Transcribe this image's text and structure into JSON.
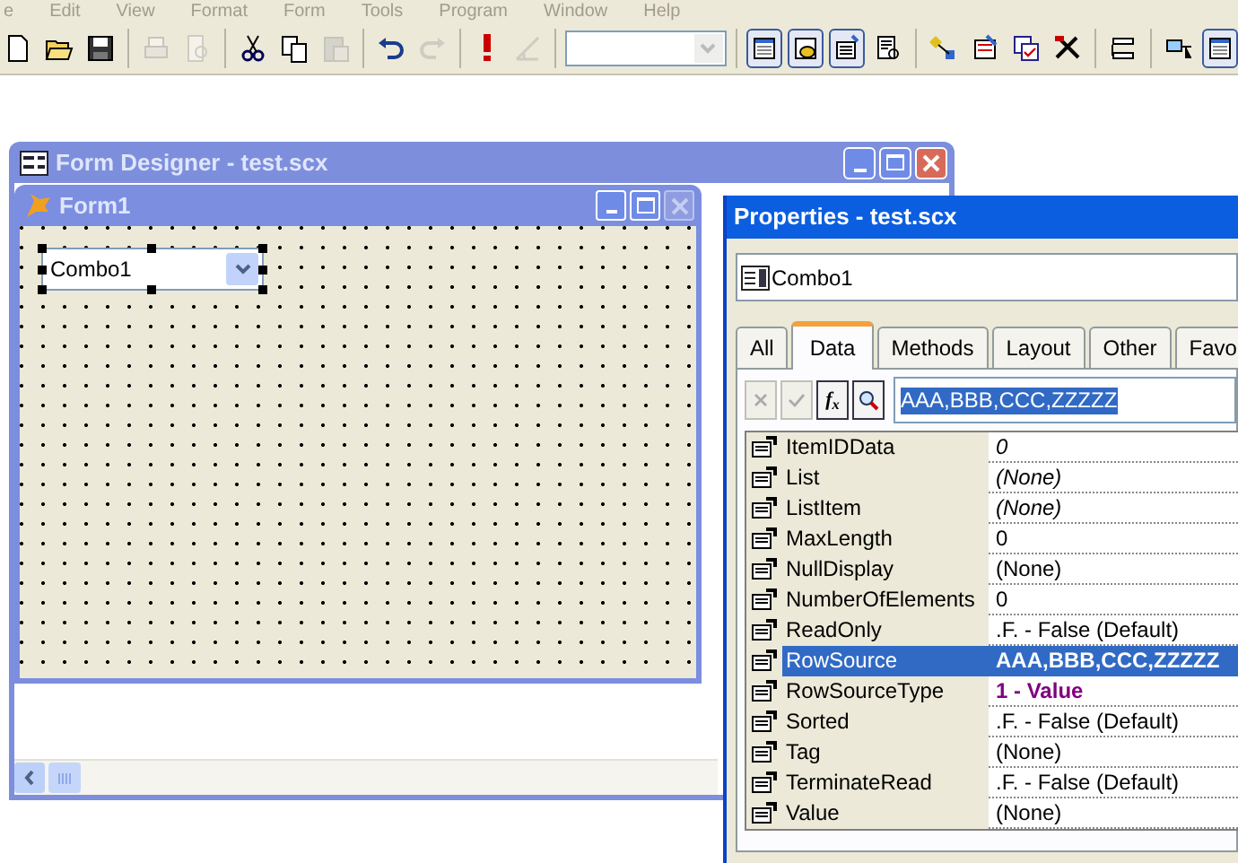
{
  "menu_bar": [
    "e",
    "Edit",
    "View",
    "Format",
    "Form",
    "Tools",
    "Program",
    "Window",
    "Help"
  ],
  "toolbar": [
    {
      "kind": "new",
      "disabled": false
    },
    {
      "kind": "open",
      "disabled": false
    },
    {
      "kind": "save",
      "disabled": false
    },
    {
      "kind": "sep"
    },
    {
      "kind": "print",
      "disabled": true
    },
    {
      "kind": "preview",
      "disabled": true
    },
    {
      "kind": "sep"
    },
    {
      "kind": "cut",
      "disabled": false
    },
    {
      "kind": "copy",
      "disabled": false
    },
    {
      "kind": "paste",
      "disabled": true
    },
    {
      "kind": "sep"
    },
    {
      "kind": "undo",
      "disabled": false
    },
    {
      "kind": "redo",
      "disabled": true
    },
    {
      "kind": "sep"
    },
    {
      "kind": "run",
      "disabled": false
    },
    {
      "kind": "wizard",
      "disabled": true
    },
    {
      "kind": "sep"
    },
    {
      "kind": "combo"
    },
    {
      "kind": "sep"
    },
    {
      "kind": "form",
      "pressed": true
    },
    {
      "kind": "data",
      "pressed": true
    },
    {
      "kind": "props",
      "pressed": true
    },
    {
      "kind": "code",
      "pressed": false
    },
    {
      "kind": "sep"
    },
    {
      "kind": "layout",
      "pressed": false
    },
    {
      "kind": "builder",
      "pressed": false
    },
    {
      "kind": "check",
      "pressed": false
    },
    {
      "kind": "tools",
      "pressed": false
    },
    {
      "kind": "sep"
    },
    {
      "kind": "list",
      "pressed": false
    },
    {
      "kind": "sep"
    },
    {
      "kind": "connect",
      "pressed": false
    },
    {
      "kind": "form",
      "pressed": true
    }
  ],
  "form_designer": {
    "title": "Form Designer - test.scx",
    "form": {
      "title": "Form1",
      "combo": "Combo1"
    }
  },
  "properties": {
    "title": "Properties - test.scx",
    "object": "Combo1",
    "tabs": [
      {
        "label": "All",
        "selected": false
      },
      {
        "label": "Data",
        "selected": true
      },
      {
        "label": "Methods",
        "selected": false
      },
      {
        "label": "Layout",
        "selected": false
      },
      {
        "label": "Other",
        "selected": false
      },
      {
        "label": "Favo",
        "selected": false
      }
    ],
    "function_button": "f$_{x}$",
    "edit_value": "AAA,BBB,CCC,ZZZZZ",
    "rows": [
      {
        "name": "ItemIDData",
        "value": "0",
        "kind": "readonly",
        "selected": false
      },
      {
        "name": "List",
        "value": "(None)",
        "kind": "readonly",
        "selected": false
      },
      {
        "name": "ListItem",
        "value": "(None)",
        "kind": "readonly",
        "selected": false
      },
      {
        "name": "MaxLength",
        "value": "0",
        "kind": "default",
        "selected": false
      },
      {
        "name": "NullDisplay",
        "value": "(None)",
        "kind": "default",
        "selected": false
      },
      {
        "name": "NumberOfElements",
        "value": "0",
        "kind": "default",
        "selected": false
      },
      {
        "name": "ReadOnly",
        "value": ".F. - False (Default)",
        "kind": "default",
        "selected": false
      },
      {
        "name": "RowSource",
        "value": "AAA,BBB,CCC,ZZZZZ",
        "kind": "modified",
        "selected": true
      },
      {
        "name": "RowSourceType",
        "value": "1 - Value",
        "kind": "modified",
        "selected": false
      },
      {
        "name": "Sorted",
        "value": ".F. - False (Default)",
        "kind": "default",
        "selected": false
      },
      {
        "name": "Tag",
        "value": "(None)",
        "kind": "default",
        "selected": false
      },
      {
        "name": "TerminateRead",
        "value": ".F. - False (Default)",
        "kind": "default",
        "selected": false
      },
      {
        "name": "Value",
        "value": "(None)",
        "kind": "default",
        "selected": false
      }
    ]
  }
}
